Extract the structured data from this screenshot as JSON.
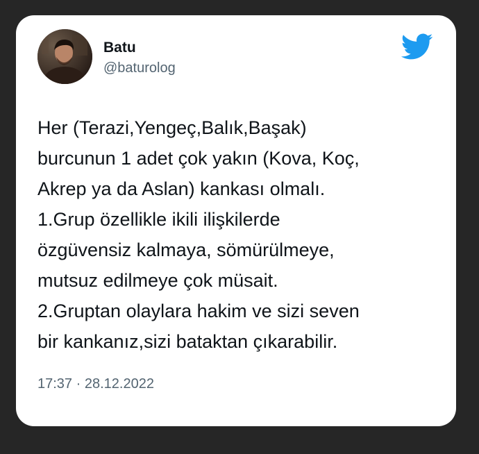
{
  "tweet": {
    "author_name": "Batu",
    "author_handle": "@baturolog",
    "lines": [
      "Her (Terazi,Yengeç,Balık,Başak)",
      "burcunun 1 adet çok yakın (Kova, Koç,",
      "Akrep ya da Aslan) kankası olmalı.",
      "1.Grup özellikle ikili ilişkilerde",
      "özgüvensiz kalmaya, sömürülmeye,",
      "mutsuz edilmeye çok müsait.",
      "2.Gruptan olaylara hakim ve sizi seven",
      "bir kankanız,sizi bataktan çıkarabilir."
    ],
    "time": "17:37",
    "separator": "·",
    "date": "28.12.2022",
    "icon": "twitter-bird-icon"
  },
  "colors": {
    "page_background": "#262626",
    "card_background": "#ffffff",
    "text_primary": "#0f1419",
    "text_secondary": "#536471",
    "twitter_blue": "#1d9bf0"
  }
}
